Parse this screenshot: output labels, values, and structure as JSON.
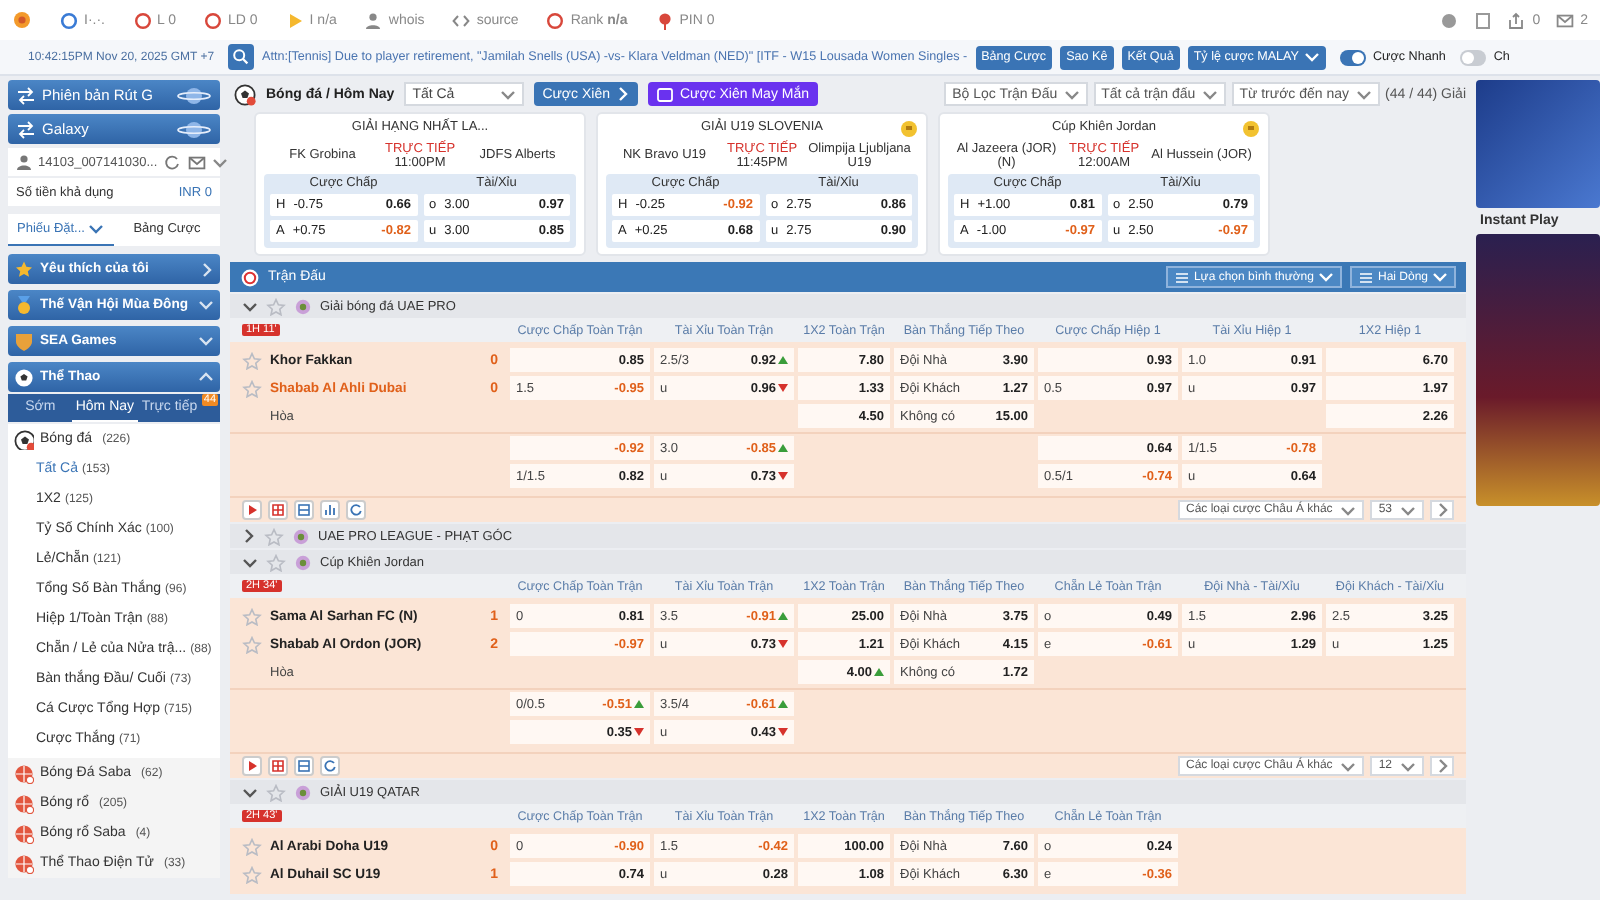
{
  "ext_toolbar": {
    "items": [
      {
        "label": "I·.·."
      },
      {
        "label": "L 0"
      },
      {
        "label": "LD 0"
      },
      {
        "label": "I n/a"
      },
      {
        "label": "whois"
      },
      {
        "label": "source"
      },
      {
        "label": "Rank **n/a**"
      },
      {
        "label": "PIN 0"
      }
    ],
    "counters": [
      {
        "label": "0"
      },
      {
        "label": "2"
      }
    ]
  },
  "header": {
    "clock": "10:42:15PM Nov 20, 2025 GMT +7",
    "ticker": "Attn:[Tennis] Due to player retirement, \"Jamilah Snells (USA) -vs- Klara Veldman (NED)\" [ITF - W15 Lousada Women Singles -",
    "buttons": [
      {
        "label": "Bảng Cược",
        "dropdown": false
      },
      {
        "label": "Sao Kê",
        "dropdown": false
      },
      {
        "label": "Kết Quả",
        "dropdown": false
      },
      {
        "label": "Tỷ lệ cược MALAY",
        "dropdown": true
      }
    ],
    "toggles": [
      {
        "label": "Cược Nhanh",
        "on": true
      },
      {
        "label": "Ch",
        "on": false
      }
    ]
  },
  "sidebar": {
    "promos": [
      {
        "label": "Phiên bản Rút G"
      },
      {
        "label": "Galaxy"
      }
    ],
    "account": {
      "user": "14103_007141030...",
      "balance_label": "Số tiền khả dụng",
      "balance": "INR 0"
    },
    "tabs": [
      {
        "label": "Phiếu Đặt...",
        "selected": true
      },
      {
        "label": "Bảng Cược",
        "selected": false
      }
    ],
    "sections": [
      {
        "label": "Yêu thích của tôi",
        "kind": "link",
        "expanded": false
      },
      {
        "label": "Thế Vận Hội Mùa Đông",
        "kind": "group",
        "expanded": false
      },
      {
        "label": "SEA Games",
        "kind": "group",
        "expanded": false
      },
      {
        "label": "Thể Thao",
        "kind": "group",
        "expanded": true
      }
    ],
    "subtabs": [
      {
        "label": "Sớm",
        "selected": false
      },
      {
        "label": "Hôm Nay",
        "selected": true
      },
      {
        "label": "Trực tiếp",
        "selected": false,
        "badge": "44"
      }
    ],
    "sports": [
      {
        "label": "Bóng đá",
        "count": "(226)",
        "expanded": true,
        "children": [
          {
            "label": "Tất Cả",
            "count": "(153)",
            "selected": true
          },
          {
            "label": "1X2",
            "count": "(125)",
            "selected": false
          },
          {
            "label": "Tỷ Số Chính Xác",
            "count": "(100)",
            "selected": false
          },
          {
            "label": "Lẻ/Chẵn",
            "count": "(121)",
            "selected": false
          },
          {
            "label": "Tổng Số Bàn Thắng",
            "count": "(96)",
            "selected": false
          },
          {
            "label": "Hiệp 1/Toàn Trận",
            "count": "(88)",
            "selected": false
          },
          {
            "label": "Chẵn / Lẻ của Nửa trậ...",
            "count": "(88)",
            "selected": false
          },
          {
            "label": "Bàn thắng Đầu/ Cuối",
            "count": "(73)",
            "selected": false
          },
          {
            "label": "Cá Cược Tổng Hợp",
            "count": "(715)",
            "selected": false
          },
          {
            "label": "Cược Thắng",
            "count": "(71)",
            "selected": false
          }
        ]
      },
      {
        "label": "Bóng Đá Saba",
        "count": "(62)",
        "expanded": false
      },
      {
        "label": "Bóng rổ",
        "count": "(205)",
        "expanded": false
      },
      {
        "label": "Bóng rổ Saba",
        "count": "(4)",
        "expanded": false
      },
      {
        "label": "Thể Thao Điện Tử",
        "count": "(33)",
        "expanded": false
      }
    ]
  },
  "toolbar": {
    "title": "Bóng đá / Hôm Nay",
    "select": "Tất Cả",
    "parlay": "Cược Xiên",
    "lucky_parlay": "Cược Xiên May Mắn",
    "filters": [
      "Bộ Lọc Trận Đấu",
      "Tất cả trận đấu",
      "Từ trước đến nay"
    ],
    "league_count": "(44 / 44) Giải"
  },
  "featured": [
    {
      "league": "GIẢI HẠNG NHẤT LA...",
      "favorite": false,
      "home": "FK Grobina",
      "status": "TRỰC TIẾP",
      "time": "11:00PM",
      "away": "JDFS Alberts",
      "headers": [
        "Cược Chấp",
        "Tài/Xỉu"
      ],
      "rows": [
        [
          {
            "side": "H",
            "line": "-0.75",
            "odds": "0.66",
            "neg": false
          },
          {
            "side": "o",
            "line": "3.00",
            "odds": "0.97",
            "neg": false
          }
        ],
        [
          {
            "side": "A",
            "line": "+0.75",
            "odds": "-0.82",
            "neg": true
          },
          {
            "side": "u",
            "line": "3.00",
            "odds": "0.85",
            "neg": false
          }
        ]
      ]
    },
    {
      "league": "GIẢI U19 SLOVENIA",
      "favorite": true,
      "home": "NK Bravo U19",
      "status": "TRỰC TIẾP",
      "time": "11:45PM",
      "away": "Olimpija Ljubljana U19",
      "headers": [
        "Cược Chấp",
        "Tài/Xỉu"
      ],
      "rows": [
        [
          {
            "side": "H",
            "line": "-0.25",
            "odds": "-0.92",
            "neg": true
          },
          {
            "side": "o",
            "line": "2.75",
            "odds": "0.86",
            "neg": false
          }
        ],
        [
          {
            "side": "A",
            "line": "+0.25",
            "odds": "0.68",
            "neg": false
          },
          {
            "side": "u",
            "line": "2.75",
            "odds": "0.90",
            "neg": false
          }
        ]
      ]
    },
    {
      "league": "Cúp Khiên Jordan",
      "favorite": true,
      "home": "Al Jazeera (JOR) (N)",
      "status": "TRỰC TIẾP",
      "time": "12:00AM",
      "away": "Al Hussein (JOR)",
      "headers": [
        "Cược Chấp",
        "Tài/Xỉu"
      ],
      "rows": [
        [
          {
            "side": "H",
            "line": "+1.00",
            "odds": "0.81",
            "neg": false
          },
          {
            "side": "o",
            "line": "2.50",
            "odds": "0.79",
            "neg": false
          }
        ],
        [
          {
            "side": "A",
            "line": "-1.00",
            "odds": "-0.97",
            "neg": true
          },
          {
            "side": "u",
            "line": "2.50",
            "odds": "-0.97",
            "neg": true
          }
        ]
      ]
    }
  ],
  "matches_panel": {
    "title": "Trận Đấu",
    "view": "Lựa chọn bình thường",
    "lines": "Hai Dòng",
    "leagues": [
      {
        "name": "Giải bóng đá UAE PRO",
        "expanded": true,
        "clock": "1H 11'",
        "columns": [
          "Cược Chấp Toàn Trận",
          "Tài Xỉu Toàn Trận",
          "1X2 Toàn Trận",
          "Bàn Thắng Tiếp Theo",
          "Cược Chấp Hiệp 1",
          "Tài Xỉu Hiệp 1",
          "1X2 Hiệp 1"
        ],
        "blocks": [
          [
            {
              "kind": "team",
              "team": "Khor Fakkan",
              "score": "0",
              "favored": false,
              "cells": [
                {
                  "kind": "steady",
                  "odds": "0.85",
                  "neg": false
                },
                {
                  "kind": "up",
                  "line": "2.5/3",
                  "odds": "0.92",
                  "neg": false
                },
                {
                  "kind": "steady",
                  "odds": "7.80",
                  "neg": false
                },
                {
                  "kind": "steady",
                  "line": "Đội Nhà",
                  "odds": "3.90",
                  "neg": false
                },
                {
                  "kind": "steady",
                  "odds": "0.93",
                  "neg": false
                },
                {
                  "kind": "steady",
                  "line": "1.0",
                  "odds": "0.91",
                  "neg": false
                },
                {
                  "kind": "steady",
                  "odds": "6.70",
                  "neg": false
                }
              ]
            },
            {
              "kind": "team",
              "team": "Shabab Al Ahli Dubai",
              "score": "0",
              "favored": true,
              "cells": [
                {
                  "kind": "steady",
                  "line": "1.5",
                  "odds": "-0.95",
                  "neg": true
                },
                {
                  "kind": "down",
                  "line": "u",
                  "odds": "0.96",
                  "neg": false
                },
                {
                  "kind": "steady",
                  "odds": "1.33",
                  "neg": false
                },
                {
                  "kind": "steady",
                  "line": "Đội Khách",
                  "odds": "1.27",
                  "neg": false
                },
                {
                  "kind": "steady",
                  "line": "0.5",
                  "odds": "0.97",
                  "neg": false
                },
                {
                  "kind": "steady",
                  "line": "u",
                  "odds": "0.97",
                  "neg": false
                },
                {
                  "kind": "steady",
                  "odds": "1.97",
                  "neg": false
                }
              ]
            },
            {
              "kind": "draw",
              "team": "Hòa",
              "cells": [
                null,
                null,
                {
                  "kind": "steady",
                  "odds": "4.50",
                  "neg": false
                },
                {
                  "kind": "steady",
                  "line": "Không có",
                  "odds": "15.00",
                  "neg": false
                },
                null,
                null,
                {
                  "kind": "steady",
                  "odds": "2.26",
                  "neg": false
                }
              ]
            }
          ],
          [
            {
              "kind": "line",
              "cells": [
                {
                  "kind": "steady",
                  "odds": "-0.92",
                  "neg": true
                },
                {
                  "kind": "up",
                  "line": "3.0",
                  "odds": "-0.85",
                  "neg": true
                },
                null,
                null,
                {
                  "kind": "steady",
                  "odds": "0.64",
                  "neg": false
                },
                {
                  "kind": "steady",
                  "line": "1/1.5",
                  "odds": "-0.78",
                  "neg": true
                },
                null
              ]
            },
            {
              "kind": "line",
              "cells": [
                {
                  "kind": "steady",
                  "line": "1/1.5",
                  "odds": "0.82",
                  "neg": false
                },
                {
                  "kind": "down",
                  "line": "u",
                  "odds": "0.73",
                  "neg": false
                },
                null,
                null,
                {
                  "kind": "steady",
                  "line": "0.5/1",
                  "odds": "-0.74",
                  "neg": true
                },
                {
                  "kind": "steady",
                  "line": "u",
                  "odds": "0.64",
                  "neg": false
                },
                null
              ]
            }
          ]
        ],
        "more": "Các loại cược Châu Á khác",
        "market_count": "53"
      },
      {
        "name": "UAE PRO LEAGUE - PHẠT GÓC",
        "expanded": false
      },
      {
        "name": "Cúp Khiên Jordan",
        "expanded": true,
        "clock": "2H 34'",
        "columns": [
          "Cược Chấp Toàn Trận",
          "Tài Xỉu Toàn Trận",
          "1X2 Toàn Trận",
          "Bàn Thắng Tiếp Theo",
          "Chẵn Lẻ Toàn Trận",
          "Đội Nhà - Tài/Xỉu",
          "Đội Khách - Tài/Xỉu"
        ],
        "blocks": [
          [
            {
              "kind": "team",
              "team": "Sama Al Sarhan FC (N)",
              "score": "1",
              "favored": false,
              "cells": [
                {
                  "kind": "steady",
                  "line": "0",
                  "odds": "0.81",
                  "neg": false
                },
                {
                  "kind": "up",
                  "line": "3.5",
                  "odds": "-0.91",
                  "neg": true
                },
                {
                  "kind": "steady",
                  "odds": "25.00",
                  "neg": false
                },
                {
                  "kind": "steady",
                  "line": "Đội Nhà",
                  "odds": "3.75",
                  "neg": false
                },
                {
                  "kind": "steady",
                  "line": "o",
                  "odds": "0.49",
                  "neg": false
                },
                {
                  "kind": "steady",
                  "line": "1.5",
                  "odds": "2.96",
                  "neg": false
                },
                {
                  "kind": "steady",
                  "line": "2.5",
                  "odds": "3.25",
                  "neg": false
                }
              ]
            },
            {
              "kind": "team",
              "team": "Shabab Al Ordon (JOR)",
              "score": "2",
              "favored": false,
              "cells": [
                {
                  "kind": "steady",
                  "odds": "-0.97",
                  "neg": true
                },
                {
                  "kind": "down",
                  "line": "u",
                  "odds": "0.73",
                  "neg": false
                },
                {
                  "kind": "steady",
                  "odds": "1.21",
                  "neg": false
                },
                {
                  "kind": "steady",
                  "line": "Đội Khách",
                  "odds": "4.15",
                  "neg": false
                },
                {
                  "kind": "steady",
                  "line": "e",
                  "odds": "-0.61",
                  "neg": true
                },
                {
                  "kind": "steady",
                  "line": "u",
                  "odds": "1.29",
                  "neg": false
                },
                {
                  "kind": "steady",
                  "line": "u",
                  "odds": "1.25",
                  "neg": false
                }
              ]
            },
            {
              "kind": "draw",
              "team": "Hòa",
              "cells": [
                null,
                null,
                {
                  "kind": "up",
                  "odds": "4.00",
                  "neg": false
                },
                {
                  "kind": "steady",
                  "line": "Không có",
                  "odds": "1.72",
                  "neg": false
                },
                null,
                null,
                null
              ]
            }
          ],
          [
            {
              "kind": "line",
              "cells": [
                {
                  "kind": "up",
                  "line": "0/0.5",
                  "odds": "-0.51",
                  "neg": true
                },
                {
                  "kind": "up",
                  "line": "3.5/4",
                  "odds": "-0.61",
                  "neg": true
                },
                null,
                null,
                null,
                null,
                null
              ]
            },
            {
              "kind": "line",
              "cells": [
                {
                  "kind": "down",
                  "odds": "0.35",
                  "neg": false
                },
                {
                  "kind": "down",
                  "line": "u",
                  "odds": "0.43",
                  "neg": false
                },
                null,
                null,
                null,
                null,
                null
              ]
            }
          ]
        ],
        "more": "Các loại cược Châu Á khác",
        "market_count": "12"
      },
      {
        "name": "GIẢI U19 QATAR",
        "expanded": true,
        "clock": "2H 43'",
        "columns": [
          "Cược Chấp Toàn Trận",
          "Tài Xỉu Toàn Trận",
          "1X2 Toàn Trận",
          "Bàn Thắng Tiếp Theo",
          "Chẵn Lẻ Toàn Trận"
        ],
        "blocks": [
          [
            {
              "kind": "team",
              "team": "Al Arabi Doha U19",
              "score": "0",
              "favored": false,
              "cells": [
                {
                  "kind": "steady",
                  "line": "0",
                  "odds": "-0.90",
                  "neg": true
                },
                {
                  "kind": "steady",
                  "line": "1.5",
                  "odds": "-0.42",
                  "neg": true
                },
                {
                  "kind": "steady",
                  "odds": "100.00",
                  "neg": false
                },
                {
                  "kind": "steady",
                  "line": "Đội Nhà",
                  "odds": "7.60",
                  "neg": false
                },
                {
                  "kind": "steady",
                  "line": "o",
                  "odds": "0.24",
                  "neg": false
                }
              ]
            },
            {
              "kind": "team",
              "team": "Al Duhail SC U19",
              "score": "1",
              "favored": false,
              "cells": [
                {
                  "kind": "steady",
                  "odds": "0.74",
                  "neg": false
                },
                {
                  "kind": "steady",
                  "line": "u",
                  "odds": "0.28",
                  "neg": false
                },
                {
                  "kind": "steady",
                  "odds": "1.08",
                  "neg": false
                },
                {
                  "kind": "steady",
                  "line": "Đội Khách",
                  "odds": "6.30",
                  "neg": false
                },
                {
                  "kind": "steady",
                  "line": "e",
                  "odds": "-0.36",
                  "neg": true
                }
              ]
            }
          ]
        ]
      }
    ]
  },
  "right_panel": {
    "section": "Instant Play"
  }
}
